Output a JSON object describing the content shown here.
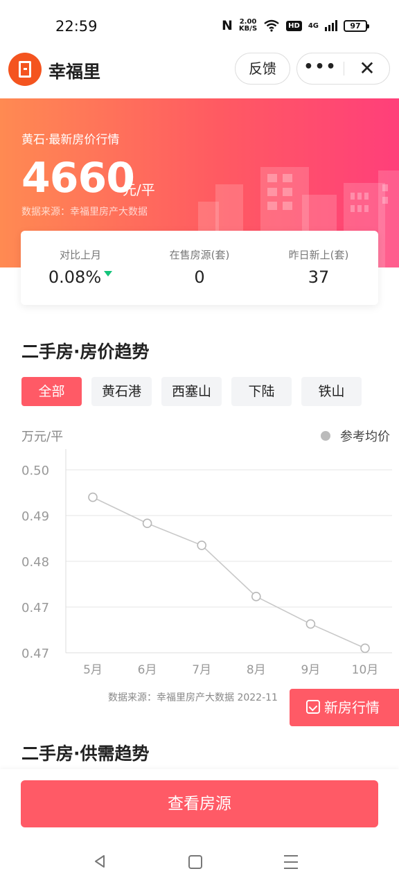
{
  "status_bar": {
    "time": "22:59",
    "nfc": "N",
    "speed_value": "2.00",
    "speed_unit": "KB/S",
    "hd": "HD",
    "network": "4G",
    "battery": "97"
  },
  "header": {
    "title": "幸福里",
    "feedback_label": "反馈",
    "more_label": "•••",
    "close_label": "✕"
  },
  "hero": {
    "subtitle": "黄石·最新房价行情",
    "price": "4660",
    "unit": "元/平",
    "source": "数据来源：幸福里房产大数据"
  },
  "stats": [
    {
      "label": "对比上月",
      "value": "0.08%",
      "trend": "down"
    },
    {
      "label": "在售房源(套)",
      "value": "0"
    },
    {
      "label": "昨日新上(套)",
      "value": "37"
    }
  ],
  "section_price_trend": {
    "title": "二手房·房价趋势",
    "tabs": [
      {
        "label": "全部",
        "active": true
      },
      {
        "label": "黄石港",
        "active": false
      },
      {
        "label": "西塞山",
        "active": false
      },
      {
        "label": "下陆",
        "active": false
      },
      {
        "label": "铁山",
        "active": false
      }
    ]
  },
  "chart_data": {
    "type": "line",
    "ylabel": "万元/平",
    "yticks": [
      "0.50",
      "0.49",
      "0.48",
      "0.47",
      "0.47"
    ],
    "ylim": [
      0.465,
      0.505
    ],
    "categories": [
      "5月",
      "6月",
      "7月",
      "8月",
      "9月",
      "10月"
    ],
    "series": [
      {
        "name": "参考均价",
        "values": [
          0.499,
          0.4933,
          0.4885,
          0.4773,
          0.4713,
          0.466
        ]
      }
    ],
    "grid": true,
    "legend": "top-right",
    "line_color": "#c8c8c8"
  },
  "chart_source": "数据来源：幸福里房产大数据 2022-11",
  "new_house_label": "新房行情",
  "section_supply": {
    "title": "二手房·供需趋势"
  },
  "bottom": {
    "view_button": "查看房源"
  },
  "colors": {
    "accent": "#ff5a66",
    "hero_start": "#ff8a52",
    "hero_end": "#ff3f7a",
    "trend_down": "#14c37a"
  }
}
